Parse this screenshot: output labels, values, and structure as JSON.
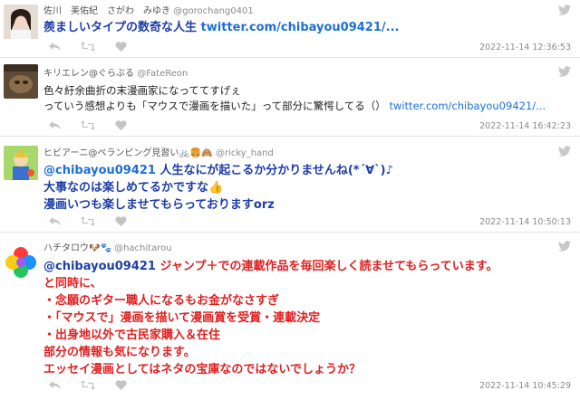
{
  "tweets": [
    {
      "name": "佐川　美佑紀　さがわ　みゆき",
      "handle": "@gorochang0401",
      "text": "羨ましいタイプの数奇な人生",
      "link": "twitter.com/chibayou09421/...",
      "timestamp": "2022-11-14 12:36:53"
    },
    {
      "name": "キリエレン@ぐらぶる",
      "handle": "@FateReon",
      "line1": "色々紆余曲折の末漫画家になっててすげぇ",
      "line2": "っていう感想よりも「マウスで漫画を描いた」って部分に驚愕してる（）",
      "link": "twitter.com/chibayou09421/...",
      "timestamp": "2022-11-14 16:42:23"
    },
    {
      "name": "ヒビアーニ@ペランピング見習い🚲🍔🙈",
      "handle": "@ricky_hand",
      "mention": "@chibayou09421",
      "line1": " 人生なにが起こるか分かりませんね(*´∀`)♪",
      "line2": "大事なのは楽しめてるかですな👍",
      "line3": "漫画いつも楽しませてもらっておりますorz",
      "timestamp": "2022-11-14 10:50:13"
    },
    {
      "name": "ハチタロウ🐶🐾",
      "handle": "@hachitarou",
      "mention": "@chibayou09421",
      "line1": " ジャンプ＋での連載作品を毎回楽しく読ませてもらっています。",
      "line2": "と同時に、",
      "line3": "・念願のギター職人になるもお金がなさすぎ",
      "line4": "・「マウスで」漫画を描いて漫画賞を受賞・連載決定",
      "line5": "・出身地以外で古民家購入＆在住",
      "line6": "部分の情報も気になります。",
      "line7": "エッセイ漫画としてはネタの宝庫なのではないでしょうか？",
      "timestamp": "2022-11-14 10:45:29"
    }
  ],
  "colors": {
    "mention": "#1d3ea8",
    "link": "#1d6fd6",
    "red_text": "#e01f1f",
    "bird": "#c8c8c8"
  },
  "icons": [
    "twitter-bird-icon",
    "reply-icon",
    "retweet-icon",
    "like-icon"
  ]
}
